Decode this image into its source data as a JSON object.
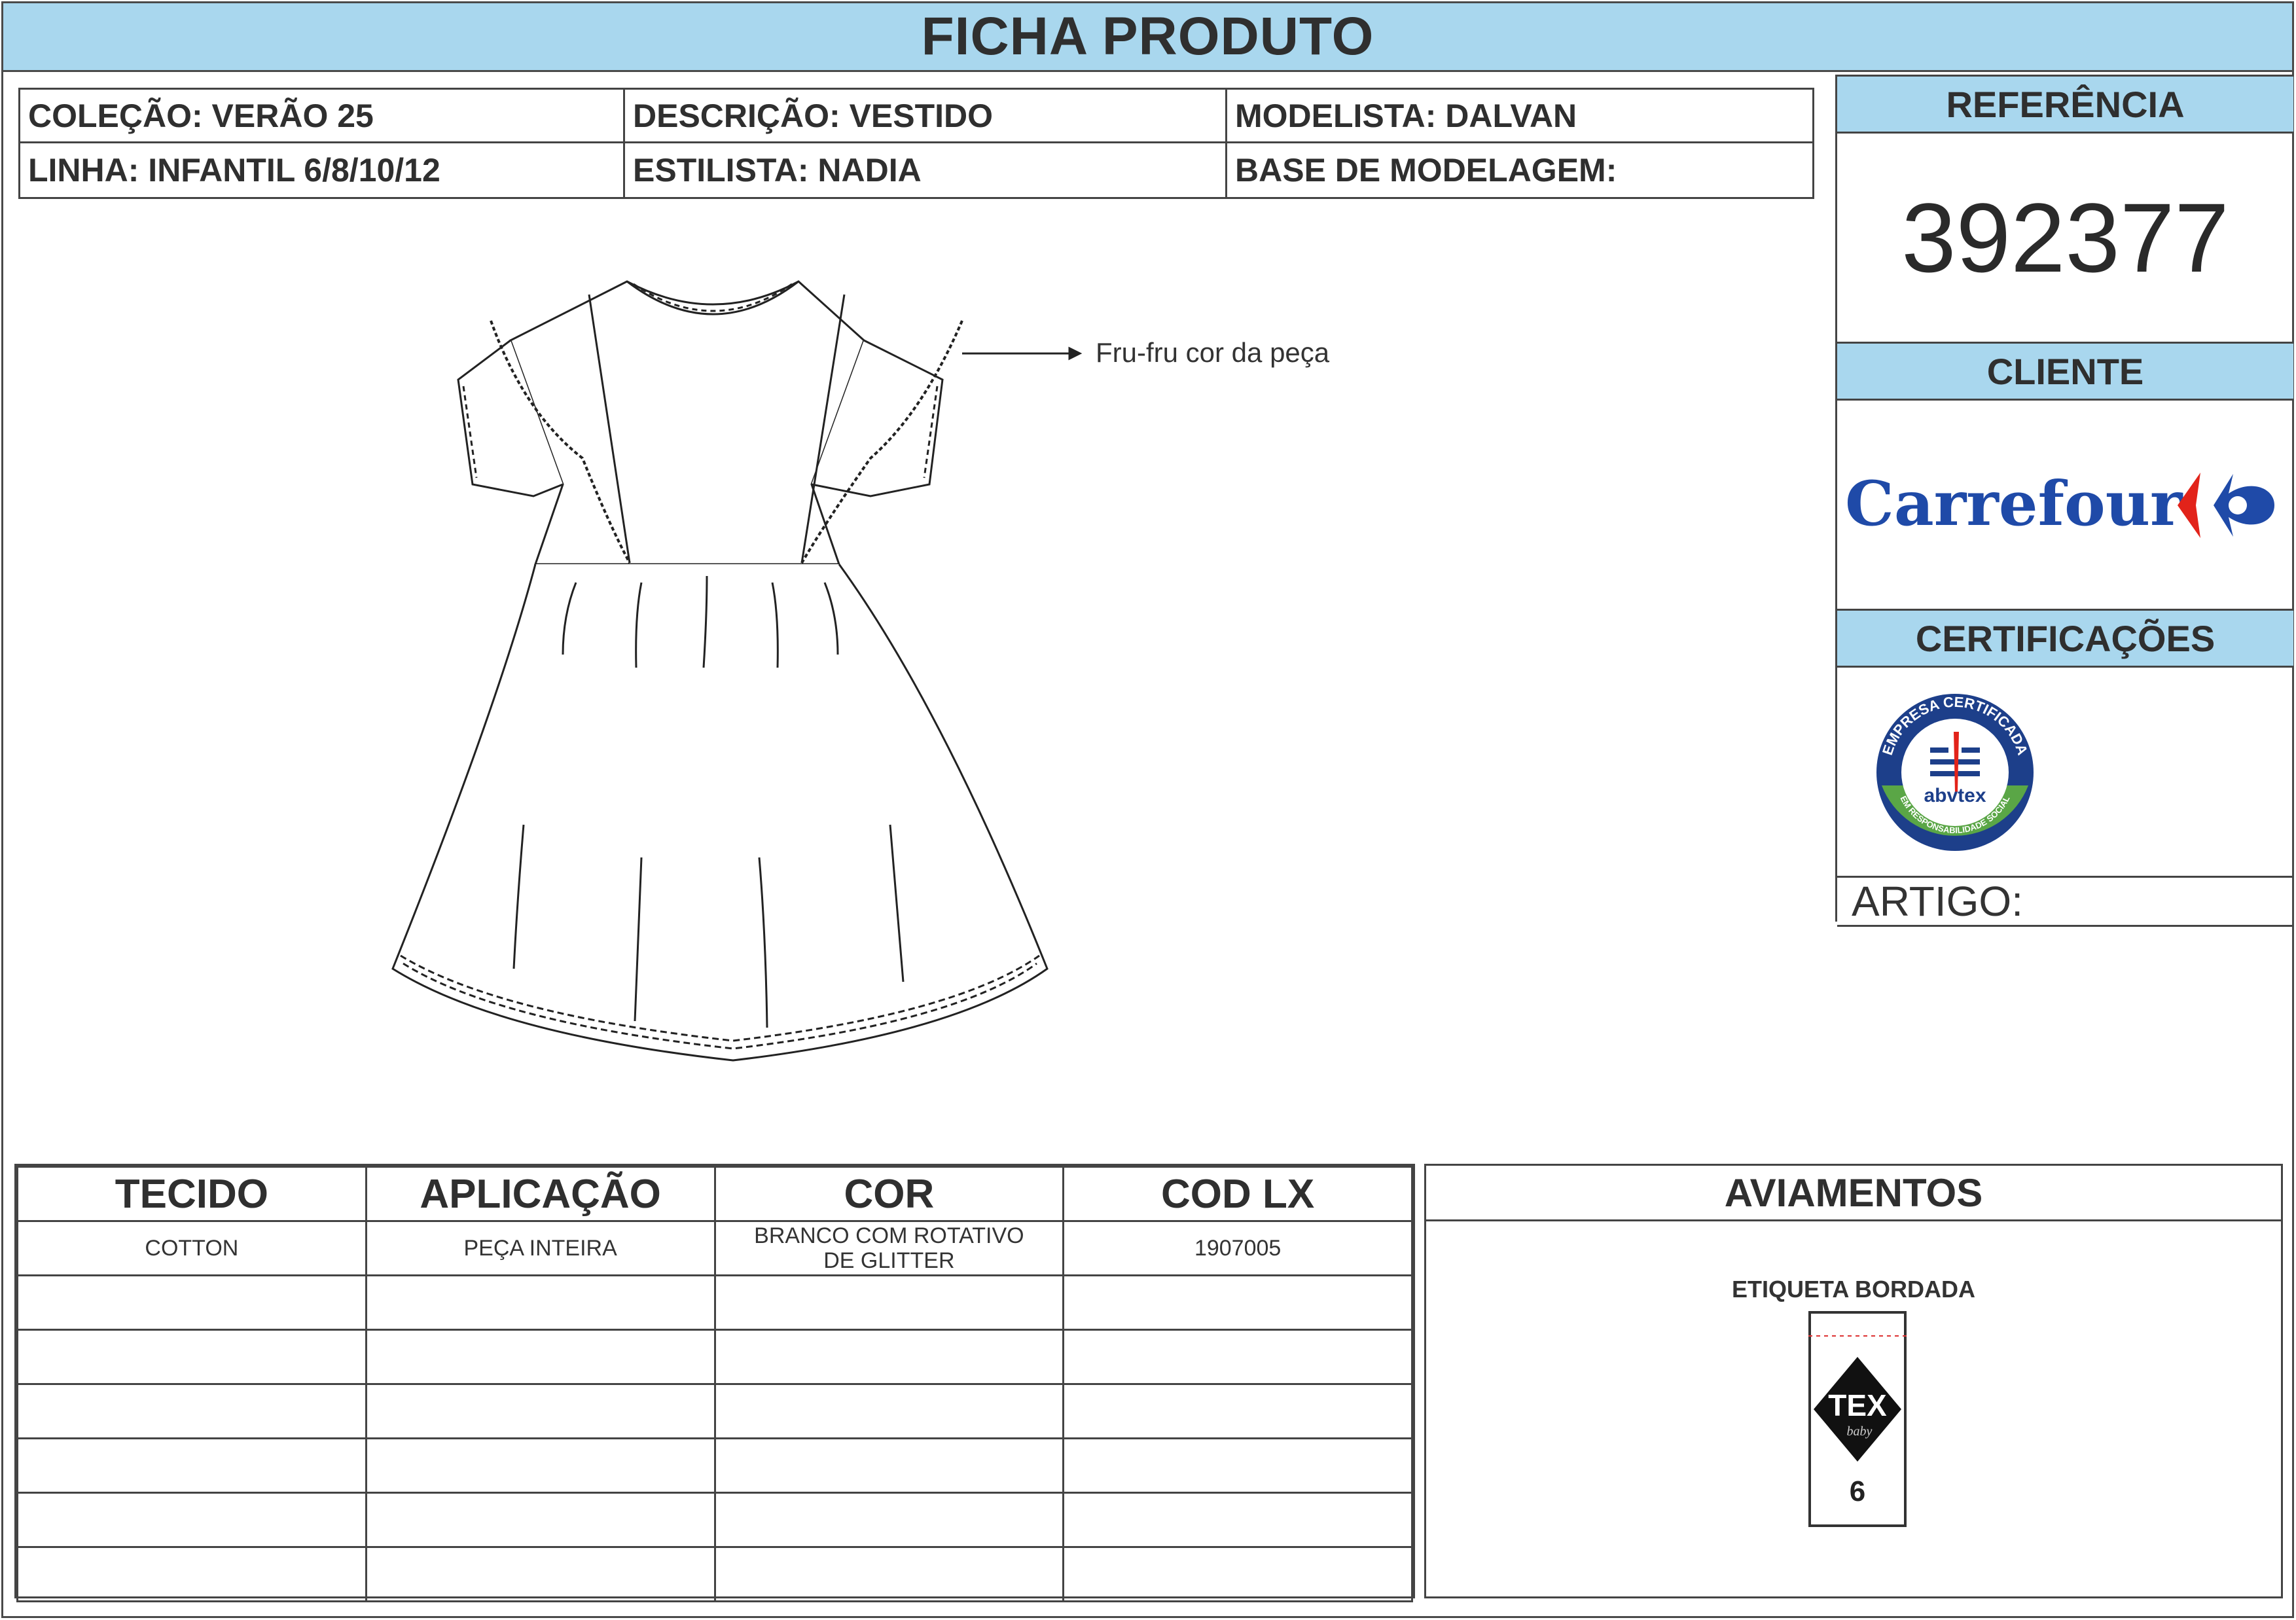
{
  "title": "FICHA PRODUTO",
  "info": {
    "colecao": "COLEÇÃO: VERÃO 25",
    "descricao": "DESCRIÇÃO: VESTIDO",
    "modelista": "MODELISTA: DALVAN",
    "linha": "LINHA: INFANTIL 6/8/10/12",
    "estilista": "ESTILISTA: NADIA",
    "base": "BASE DE MODELAGEM:"
  },
  "side": {
    "referencia_label": "REFERÊNCIA",
    "referencia": "392377",
    "cliente_label": "CLIENTE",
    "cliente_logo": "Carrefour",
    "certificacoes_label": "CERTIFICAÇÕES",
    "cert_badge": {
      "top": "EMPRESA CERTIFICADA",
      "brand": "abvtex",
      "bottom": "EM RESPONSABILIDADE SOCIAL"
    },
    "artigo": "ARTIGO:"
  },
  "drawing_note": "Fru-fru cor da peça",
  "table": {
    "headers": [
      "TECIDO",
      "APLICAÇÃO",
      "COR",
      "COD LX"
    ],
    "rows": [
      [
        "COTTON",
        "PEÇA INTEIRA",
        "BRANCO COM ROTATIVO DE GLITTER",
        "1907005"
      ],
      [
        "",
        "",
        "",
        ""
      ],
      [
        "",
        "",
        "",
        ""
      ],
      [
        "",
        "",
        "",
        ""
      ],
      [
        "",
        "",
        "",
        ""
      ],
      [
        "",
        "",
        "",
        ""
      ],
      [
        "",
        "",
        "",
        ""
      ]
    ]
  },
  "aviamentos": {
    "title": "AVIAMENTOS",
    "item_label": "ETIQUETA BORDADA",
    "tag_logo": "TEX",
    "tag_sub": "baby",
    "tag_size": "6"
  },
  "colors": {
    "header_bg": "#a9d7ee",
    "border": "#444444",
    "carrefour_blue": "#1f4aa8",
    "carrefour_red": "#e2231a",
    "abvtex_blue": "#1d3f8a",
    "abvtex_green": "#5aa646"
  }
}
